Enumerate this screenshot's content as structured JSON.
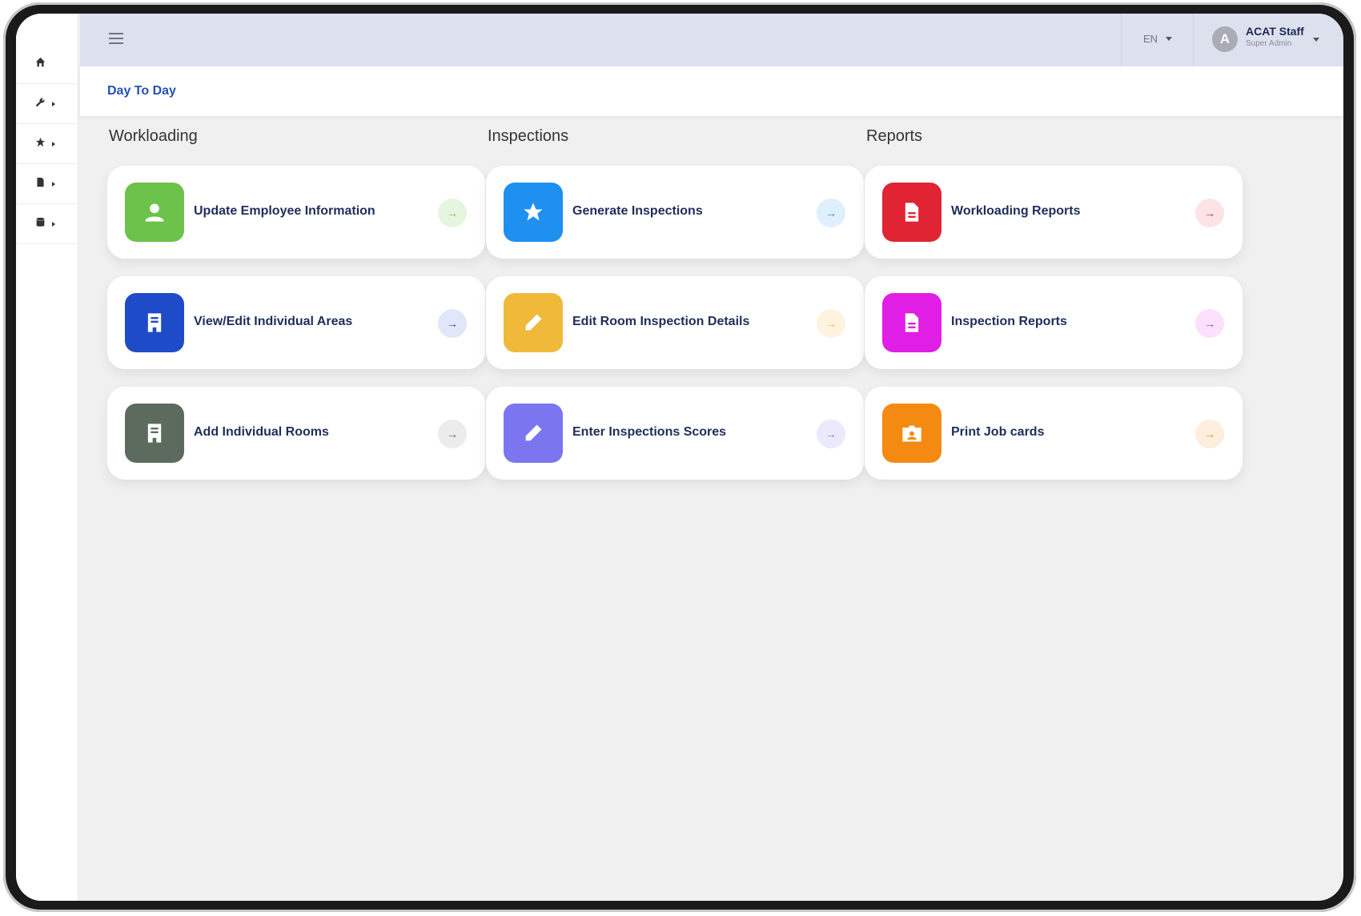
{
  "sidebar": {
    "items": [
      {
        "icon": "home-icon",
        "has_caret": false
      },
      {
        "icon": "wrench-icon",
        "has_caret": true
      },
      {
        "icon": "star-icon",
        "has_caret": true
      },
      {
        "icon": "document-icon",
        "has_caret": true
      },
      {
        "icon": "database-icon",
        "has_caret": true
      }
    ]
  },
  "header": {
    "language": "EN",
    "avatar_letter": "A",
    "user_name": "ACAT Staff",
    "user_role": "Super Admin"
  },
  "breadcrumb": "Day To Day",
  "arrow_glyph": "→",
  "columns": [
    {
      "title": "Workloading",
      "cards": [
        {
          "label": "Update Employee Information",
          "icon": "user-icon",
          "color": "#6cc24a",
          "arrow_bg": "#e6f5df",
          "arrow_color": "#6cc24a"
        },
        {
          "label": "View/Edit Individual Areas",
          "icon": "building-icon",
          "color": "#1e4bc8",
          "arrow_bg": "#e1e7f8",
          "arrow_color": "#1e4bc8"
        },
        {
          "label": "Add Individual Rooms",
          "icon": "building-icon",
          "color": "#5d6b5f",
          "arrow_bg": "#ececec",
          "arrow_color": "#5d6b5f"
        }
      ]
    },
    {
      "title": "Inspections",
      "cards": [
        {
          "label": "Generate Inspections",
          "icon": "star-icon",
          "color": "#1e90f0",
          "arrow_bg": "#e0effd",
          "arrow_color": "#1e90f0"
        },
        {
          "label": "Edit Room Inspection Details",
          "icon": "pencil-icon",
          "color": "#f0b93a",
          "arrow_bg": "#fdf3df",
          "arrow_color": "#f0b93a"
        },
        {
          "label": "Enter Inspections Scores",
          "icon": "pencil-icon",
          "color": "#7b75f0",
          "arrow_bg": "#ebeafd",
          "arrow_color": "#7b75f0"
        }
      ]
    },
    {
      "title": "Reports",
      "cards": [
        {
          "label": "Workloading Reports",
          "icon": "document-icon",
          "color": "#e02434",
          "arrow_bg": "#fde3e5",
          "arrow_color": "#e02434"
        },
        {
          "label": "Inspection Reports",
          "icon": "document-icon",
          "color": "#e11ee6",
          "arrow_bg": "#fbe1fb",
          "arrow_color": "#e11ee6"
        },
        {
          "label": "Print Job cards",
          "icon": "id-card-icon",
          "color": "#f58a12",
          "arrow_bg": "#fdeedd",
          "arrow_color": "#f58a12"
        }
      ]
    }
  ]
}
